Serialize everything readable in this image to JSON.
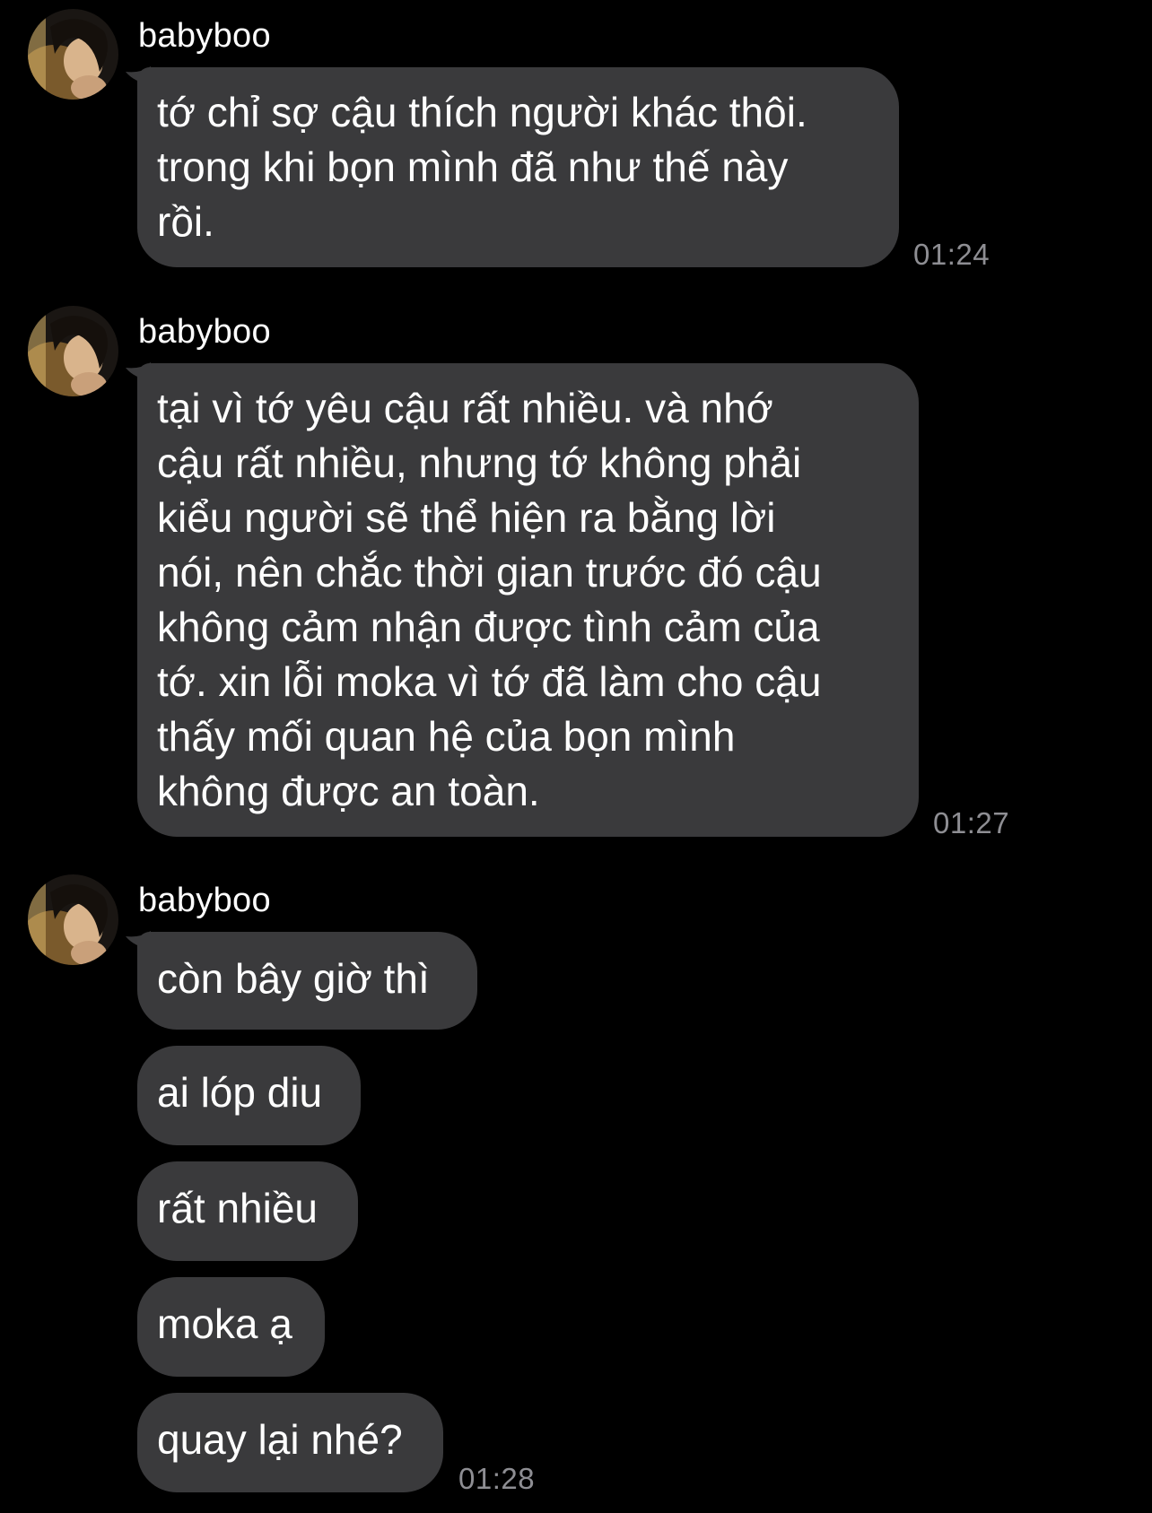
{
  "colors": {
    "background": "#000000",
    "bubble": "#3a3a3c",
    "text": "#ffffff",
    "timestamp": "#8e8e93"
  },
  "messages": [
    {
      "sender": "babyboo",
      "avatar_icon": "profile-photo-avatar",
      "bubbles": [
        "tớ chỉ sợ cậu thích người khác thôi.\ntrong khi bọn mình đã như thế này\nrồi."
      ],
      "time": "01:24"
    },
    {
      "sender": "babyboo",
      "avatar_icon": "profile-photo-avatar",
      "bubbles": [
        "tại vì tớ yêu cậu rất nhiều. và nhớ\ncậu rất nhiều, nhưng tớ không phải\nkiểu người sẽ thể hiện ra bằng lời\nnói, nên chắc thời gian trước đó cậu\nkhông cảm nhận được tình cảm của\ntớ. xin lỗi moka vì tớ đã làm cho cậu\nthấy mối quan hệ của bọn mình\nkhông được an toàn."
      ],
      "time": "01:27"
    },
    {
      "sender": "babyboo",
      "avatar_icon": "profile-photo-avatar",
      "bubbles": [
        "còn bây giờ thì",
        "ai lóp diu",
        "rất nhiều",
        "moka ạ",
        "quay lại nhé?"
      ],
      "time": "01:28"
    }
  ]
}
